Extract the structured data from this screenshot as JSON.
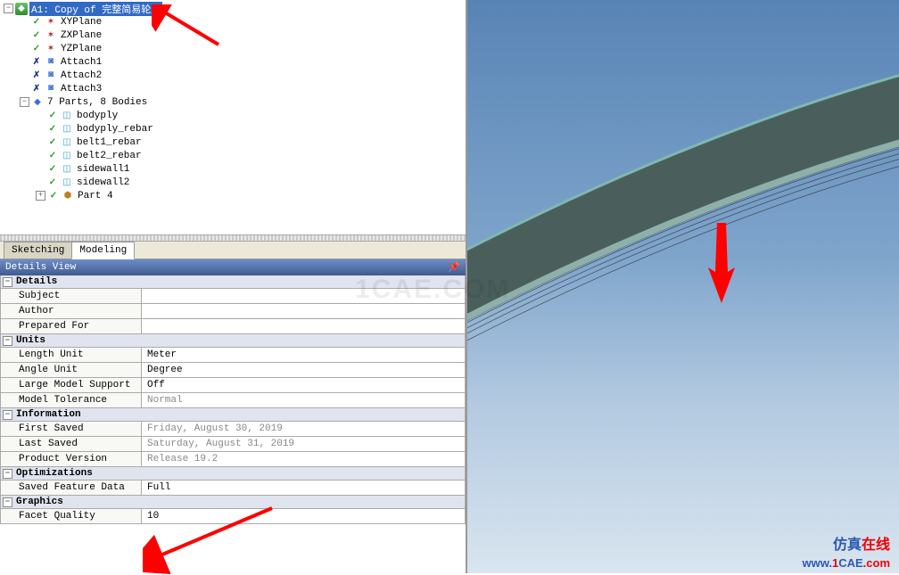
{
  "tree": {
    "root": "A1: Copy of 完整简易轮胎",
    "items": [
      "XYPlane",
      "ZXPlane",
      "YZPlane",
      "Attach1",
      "Attach2",
      "Attach3"
    ],
    "parts_summary": "7 Parts, 8 Bodies",
    "bodies": [
      "bodyply",
      "bodyply_rebar",
      "belt1_rebar",
      "belt2_rebar",
      "sidewall1",
      "sidewall2"
    ],
    "part_last": "Part 4"
  },
  "tabs": {
    "sketching": "Sketching",
    "modeling": "Modeling"
  },
  "details_title": "Details View",
  "details": {
    "sections": {
      "details": "Details",
      "units": "Units",
      "information": "Information",
      "optimizations": "Optimizations",
      "graphics": "Graphics"
    },
    "labels": {
      "subject": "Subject",
      "author": "Author",
      "prepared_for": "Prepared For",
      "length_unit": "Length Unit",
      "angle_unit": "Angle Unit",
      "large_model_support": "Large Model Support",
      "model_tolerance": "Model Tolerance",
      "first_saved": "First Saved",
      "last_saved": "Last Saved",
      "product_version": "Product Version",
      "saved_feature_data": "Saved Feature Data",
      "facet_quality": "Facet Quality"
    },
    "values": {
      "subject": "",
      "author": "",
      "prepared_for": "",
      "length_unit": "Meter",
      "angle_unit": "Degree",
      "large_model_support": "Off",
      "model_tolerance": "Normal",
      "first_saved": "Friday, August 30, 2019",
      "last_saved": "Saturday, August 31, 2019",
      "product_version": "Release 19.2",
      "saved_feature_data": "Full",
      "facet_quality": "10"
    }
  },
  "watermark": {
    "center": "1CAE.COM",
    "logo_blue": "仿真",
    "logo_red": "在线",
    "url_www": "www.",
    "url_1": "1",
    "url_cae": "CAE",
    "url_com": ".com"
  }
}
